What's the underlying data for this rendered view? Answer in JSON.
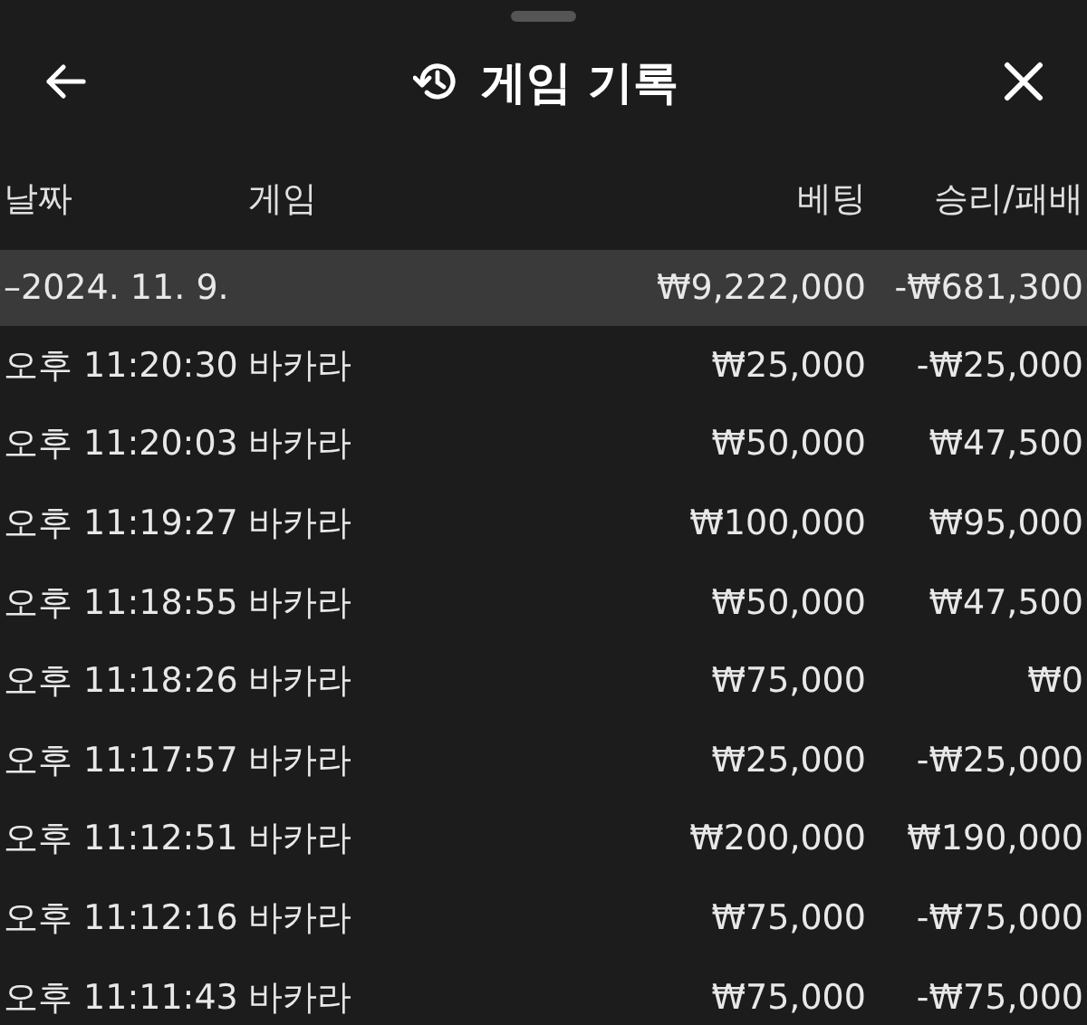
{
  "header": {
    "title": "게임 기록"
  },
  "table": {
    "columns": [
      "날짜",
      "게임",
      "베팅",
      "승리/패배"
    ],
    "rows": [
      {
        "kind": "day",
        "date": "–2024. 11. 9.",
        "bet": "₩9,222,000",
        "result": "-₩681,300"
      },
      {
        "kind": "entry",
        "date": "오후 11:20:30",
        "game": "바카라",
        "bet": "₩25,000",
        "result": "-₩25,000"
      },
      {
        "kind": "entry",
        "date": "오후 11:20:03",
        "game": "바카라",
        "bet": "₩50,000",
        "result": "₩47,500"
      },
      {
        "kind": "entry",
        "date": "오후 11:19:27",
        "game": "바카라",
        "bet": "₩100,000",
        "result": "₩95,000"
      },
      {
        "kind": "entry",
        "date": "오후 11:18:55",
        "game": "바카라",
        "bet": "₩50,000",
        "result": "₩47,500"
      },
      {
        "kind": "entry",
        "date": "오후 11:18:26",
        "game": "바카라",
        "bet": "₩75,000",
        "result": "₩0"
      },
      {
        "kind": "entry",
        "date": "오후 11:17:57",
        "game": "바카라",
        "bet": "₩25,000",
        "result": "-₩25,000"
      },
      {
        "kind": "entry",
        "date": "오후 11:12:51",
        "game": "바카라",
        "bet": "₩200,000",
        "result": "₩190,000"
      },
      {
        "kind": "entry",
        "date": "오후 11:12:16",
        "game": "바카라",
        "bet": "₩75,000",
        "result": "-₩75,000"
      },
      {
        "kind": "entry",
        "date": "오후 11:11:43",
        "game": "바카라",
        "bet": "₩75,000",
        "result": "-₩75,000"
      }
    ]
  }
}
